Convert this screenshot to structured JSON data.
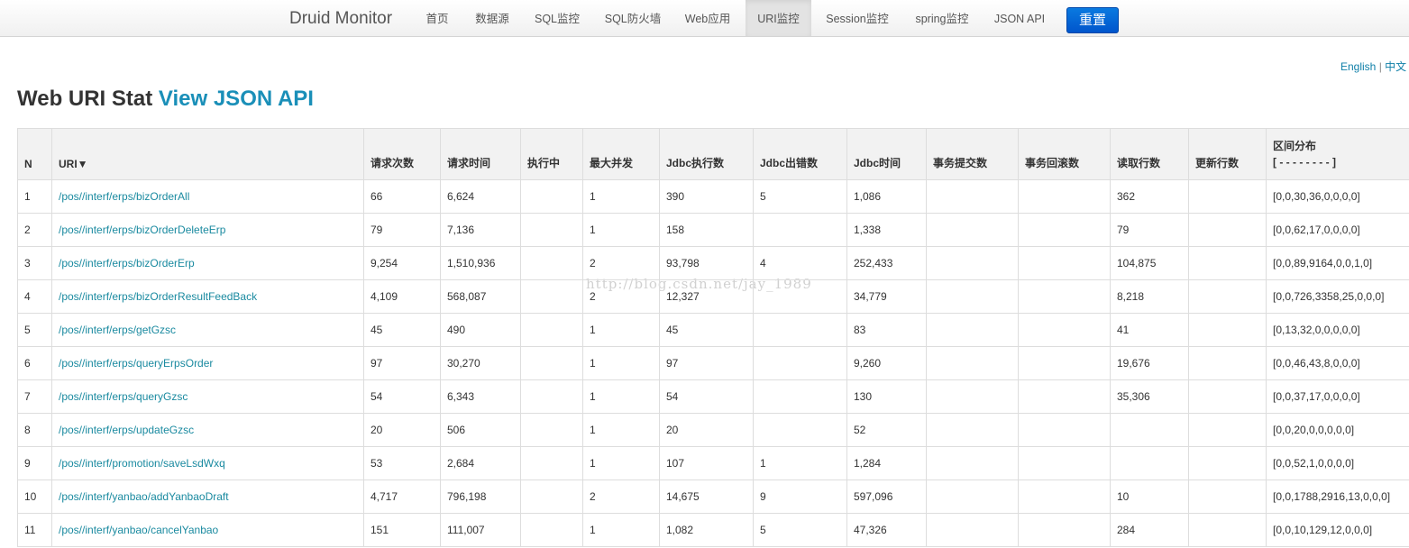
{
  "nav": {
    "brand": "Druid Monitor",
    "items": [
      {
        "label": "首页"
      },
      {
        "label": "数据源"
      },
      {
        "label": "SQL监控"
      },
      {
        "label": "SQL防火墙"
      },
      {
        "label": "Web应用"
      },
      {
        "label": "URI监控"
      },
      {
        "label": "Session监控"
      },
      {
        "label": "spring监控"
      },
      {
        "label": "JSON API"
      }
    ],
    "active_item": "URI监控",
    "reset_label": "重置"
  },
  "lang": {
    "english": "English",
    "separator": "|",
    "chinese": "中文"
  },
  "title": {
    "text": "Web URI Stat",
    "link": "View JSON API"
  },
  "watermark": "http://blog.csdn.net/jay_1989",
  "table": {
    "columns": [
      "N",
      "URI▼",
      "请求次数",
      "请求时间",
      "执行中",
      "最大并发",
      "Jdbc执行数",
      "Jdbc出错数",
      "Jdbc时间",
      "事务提交数",
      "事务回滚数",
      "读取行数",
      "更新行数",
      "区间分布"
    ],
    "dist_sub": "[ - - - - - - - - ]",
    "rows": [
      [
        "1",
        "/pos//interf/erps/bizOrderAll",
        "66",
        "6,624",
        "",
        "1",
        "390",
        "5",
        "1,086",
        "",
        "",
        "362",
        "",
        "[0,0,30,36,0,0,0,0]"
      ],
      [
        "2",
        "/pos//interf/erps/bizOrderDeleteErp",
        "79",
        "7,136",
        "",
        "1",
        "158",
        "",
        "1,338",
        "",
        "",
        "79",
        "",
        "[0,0,62,17,0,0,0,0]"
      ],
      [
        "3",
        "/pos//interf/erps/bizOrderErp",
        "9,254",
        "1,510,936",
        "",
        "2",
        "93,798",
        "4",
        "252,433",
        "",
        "",
        "104,875",
        "",
        "[0,0,89,9164,0,0,1,0]"
      ],
      [
        "4",
        "/pos//interf/erps/bizOrderResultFeedBack",
        "4,109",
        "568,087",
        "",
        "2",
        "12,327",
        "",
        "34,779",
        "",
        "",
        "8,218",
        "",
        "[0,0,726,3358,25,0,0,0]"
      ],
      [
        "5",
        "/pos//interf/erps/getGzsc",
        "45",
        "490",
        "",
        "1",
        "45",
        "",
        "83",
        "",
        "",
        "41",
        "",
        "[0,13,32,0,0,0,0,0]"
      ],
      [
        "6",
        "/pos//interf/erps/queryErpsOrder",
        "97",
        "30,270",
        "",
        "1",
        "97",
        "",
        "9,260",
        "",
        "",
        "19,676",
        "",
        "[0,0,46,43,8,0,0,0]"
      ],
      [
        "7",
        "/pos//interf/erps/queryGzsc",
        "54",
        "6,343",
        "",
        "1",
        "54",
        "",
        "130",
        "",
        "",
        "35,306",
        "",
        "[0,0,37,17,0,0,0,0]"
      ],
      [
        "8",
        "/pos//interf/erps/updateGzsc",
        "20",
        "506",
        "",
        "1",
        "20",
        "",
        "52",
        "",
        "",
        "",
        "",
        "[0,0,20,0,0,0,0,0]"
      ],
      [
        "9",
        "/pos//interf/promotion/saveLsdWxq",
        "53",
        "2,684",
        "",
        "1",
        "107",
        "1",
        "1,284",
        "",
        "",
        "",
        "",
        "[0,0,52,1,0,0,0,0]"
      ],
      [
        "10",
        "/pos//interf/yanbao/addYanbaoDraft",
        "4,717",
        "796,198",
        "",
        "2",
        "14,675",
        "9",
        "597,096",
        "",
        "",
        "10",
        "",
        "[0,0,1788,2916,13,0,0,0]"
      ],
      [
        "11",
        "/pos//interf/yanbao/cancelYanbao",
        "151",
        "111,007",
        "",
        "1",
        "1,082",
        "5",
        "47,326",
        "",
        "",
        "284",
        "",
        "[0,0,10,129,12,0,0,0]"
      ]
    ]
  }
}
